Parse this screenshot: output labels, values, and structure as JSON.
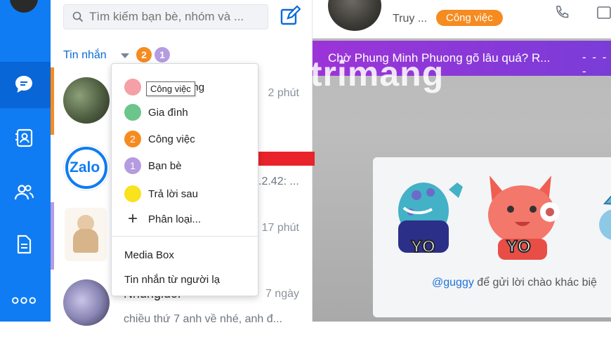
{
  "search": {
    "placeholder": "Tìm kiếm bạn bè, nhóm và ..."
  },
  "filter": {
    "label": "Tin nhắn",
    "badge1": "2",
    "badge2": "1",
    "badge1_color": "#f68b1f",
    "badge2_color": "#b59be0"
  },
  "conversations": [
    {
      "time": "2 phút",
      "avatar": "photo-avatar-icon"
    },
    {
      "time": "",
      "snippet": ".2.42: ...",
      "avatar": "zalo-logo-icon",
      "logo_text": "Zalo"
    },
    {
      "time": "17 phút",
      "avatar": "girl-illustration-avatar-icon"
    },
    {
      "name": "Nhungldoi",
      "time": "7 ngày",
      "snippet": "chiều thứ 7 anh về nhé, anh đ...",
      "avatar": "blurred-photo-avatar-icon"
    }
  ],
  "dropdown": {
    "items": [
      {
        "label": "Khách hàng",
        "color": "#f4a0a6",
        "count": ""
      },
      {
        "label": "Gia đình",
        "color": "#6cc58b",
        "count": ""
      },
      {
        "label": "Công việc",
        "color": "#f68b1f",
        "count": "2"
      },
      {
        "label": "Bạn bè",
        "color": "#b59be0",
        "count": "1"
      },
      {
        "label": "Trả lời sau",
        "color": "#f9e21e",
        "count": ""
      }
    ],
    "add_label": "Phân loại...",
    "media_box": "Media Box",
    "stranger": "Tin nhắn từ người lạ"
  },
  "tooltip": "Công việc",
  "chat": {
    "name": "Truy ...",
    "tag": "Công việc",
    "tag_color": "#f68b1f",
    "banner": "Chờ Phung Minh Phuong gõ lâu quá? R...",
    "greeting_mention": "@guggy",
    "greeting_text": " để gửi lời chào khác biệ",
    "sticker_text_1": "YO",
    "sticker_text_2": "YO"
  },
  "watermark": "uantrimang",
  "colors": {
    "brand": "#0f7cf3",
    "arrow": "#e8232a",
    "link": "#0a6bd8"
  },
  "nav_icons": [
    "message-icon",
    "contacts-icon",
    "group-icon",
    "document-icon",
    "more-icon"
  ]
}
